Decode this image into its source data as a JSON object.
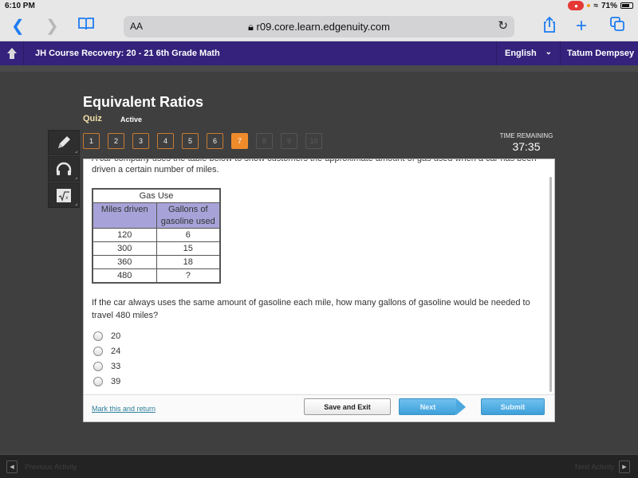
{
  "status_bar": {
    "time": "6:10 PM",
    "battery": "71%"
  },
  "browser": {
    "text_size_label": "AA",
    "url": "r09.core.learn.edgenuity.com"
  },
  "course_bar": {
    "course_title": "JH Course Recovery: 20 - 21 6th Grade Math",
    "language": "English",
    "user_name": "Tatum Dempsey"
  },
  "activity": {
    "title": "Equivalent Ratios",
    "type": "Quiz",
    "status": "Active"
  },
  "question_nav": [
    {
      "label": "1",
      "state": "visited"
    },
    {
      "label": "2",
      "state": "visited"
    },
    {
      "label": "3",
      "state": "visited"
    },
    {
      "label": "4",
      "state": "visited"
    },
    {
      "label": "5",
      "state": "visited"
    },
    {
      "label": "6",
      "state": "visited"
    },
    {
      "label": "7",
      "state": "current"
    },
    {
      "label": "8",
      "state": "disabled"
    },
    {
      "label": "9",
      "state": "disabled"
    },
    {
      "label": "10",
      "state": "disabled"
    }
  ],
  "timer": {
    "label": "TIME REMAINING",
    "value": "37:35"
  },
  "tools": [
    {
      "name": "pencil-tool"
    },
    {
      "name": "audio-tool"
    },
    {
      "name": "formula-tool"
    }
  ],
  "question": {
    "intro_partial": "A car company uses the table below to show customers the approximate amount of gas used when a car has been",
    "intro_continued": "driven a certain number of miles.",
    "table": {
      "caption": "Gas Use",
      "headers": [
        "Miles driven",
        "Gallons of gasoline used"
      ],
      "rows": [
        [
          "120",
          "6"
        ],
        [
          "300",
          "15"
        ],
        [
          "360",
          "18"
        ],
        [
          "480",
          "?"
        ]
      ]
    },
    "prompt": "If the car always uses the same amount of gasoline each mile, how many gallons of gasoline would be needed to travel 480 miles?",
    "choices": [
      "20",
      "24",
      "33",
      "39"
    ]
  },
  "footer": {
    "mark_link": "Mark this and return",
    "save_exit": "Save and Exit",
    "next": "Next",
    "submit": "Submit"
  },
  "bottom_bar": {
    "previous": "Previous Activity",
    "next": "Next Activity"
  }
}
